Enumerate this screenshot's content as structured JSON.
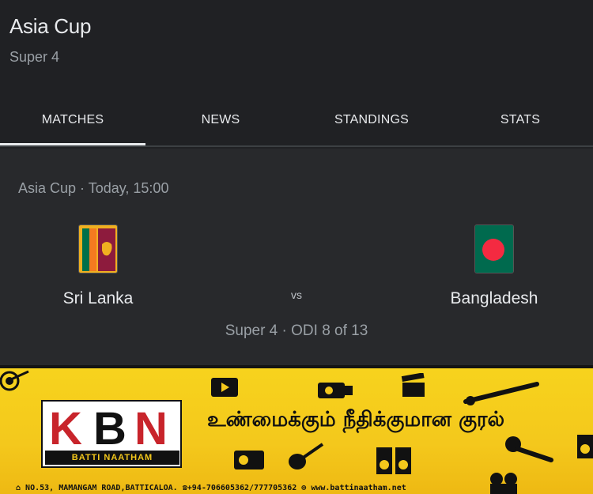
{
  "header": {
    "title": "Asia Cup",
    "subtitle": "Super 4"
  },
  "tabs": [
    {
      "label": "MATCHES",
      "active": true
    },
    {
      "label": "NEWS",
      "active": false
    },
    {
      "label": "STANDINGS",
      "active": false
    },
    {
      "label": "STATS",
      "active": false
    }
  ],
  "match": {
    "meta": "Asia Cup · Today, 15:00",
    "home_team": "Sri Lanka",
    "home_flag_icon": "sri-lanka-flag-icon",
    "away_team": "Bangladesh",
    "away_flag_icon": "bangladesh-flag-icon",
    "vs_label": "vs",
    "round": "Super 4 · ODI 8 of 13"
  },
  "banner": {
    "logo_letters": "KBN",
    "logo_sub": "BATTI NAATHAM",
    "tagline": "உண்மைக்கும் நீதிக்குமான குரல்",
    "address": "NO.53, MAMANGAM ROAD,BATTICALOA.",
    "phone": "+94-706605362/777705362",
    "website": "www.battinaatham.net",
    "colors": {
      "background": "#f4c81c",
      "logo_red": "#c8242b"
    }
  }
}
